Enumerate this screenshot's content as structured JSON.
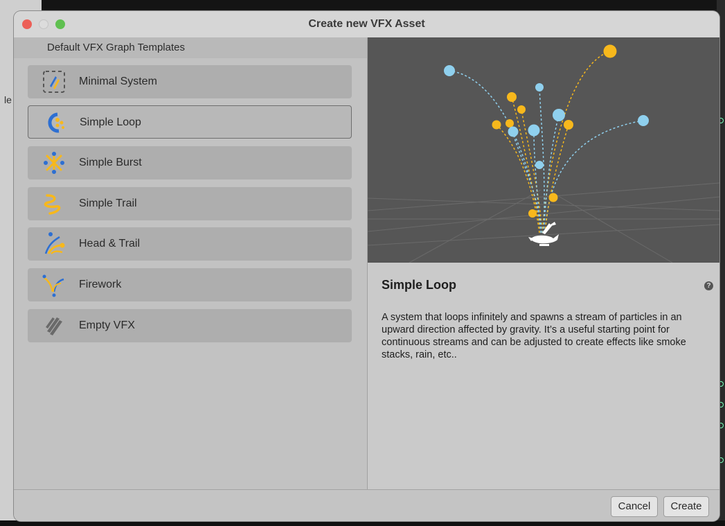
{
  "background": {
    "stray_text": "le"
  },
  "window": {
    "title": "Create new VFX Asset"
  },
  "templates": {
    "header": "Default VFX Graph Templates",
    "items": [
      {
        "label": "Minimal System",
        "icon": "minimal-system-icon"
      },
      {
        "label": "Simple Loop",
        "icon": "simple-loop-icon",
        "selected": true
      },
      {
        "label": "Simple Burst",
        "icon": "simple-burst-icon"
      },
      {
        "label": "Simple Trail",
        "icon": "simple-trail-icon"
      },
      {
        "label": "Head & Trail",
        "icon": "head-and-trail-icon"
      },
      {
        "label": "Firework",
        "icon": "firework-icon"
      },
      {
        "label": "Empty VFX",
        "icon": "empty-vfx-icon"
      }
    ]
  },
  "details": {
    "title": "Simple Loop",
    "description": "A system that loops infinitely and spawns a stream of particles in an upward direction affected by gravity. It’s a useful starting point for continuous streams and can be adjusted  to create effects like smoke stacks, rain, etc..",
    "help_icon": "?"
  },
  "footer": {
    "cancel_label": "Cancel",
    "create_label": "Create"
  },
  "colors": {
    "yellow": "#f7b81c",
    "blue": "#8fd0ee",
    "preview_bg": "#565656"
  }
}
